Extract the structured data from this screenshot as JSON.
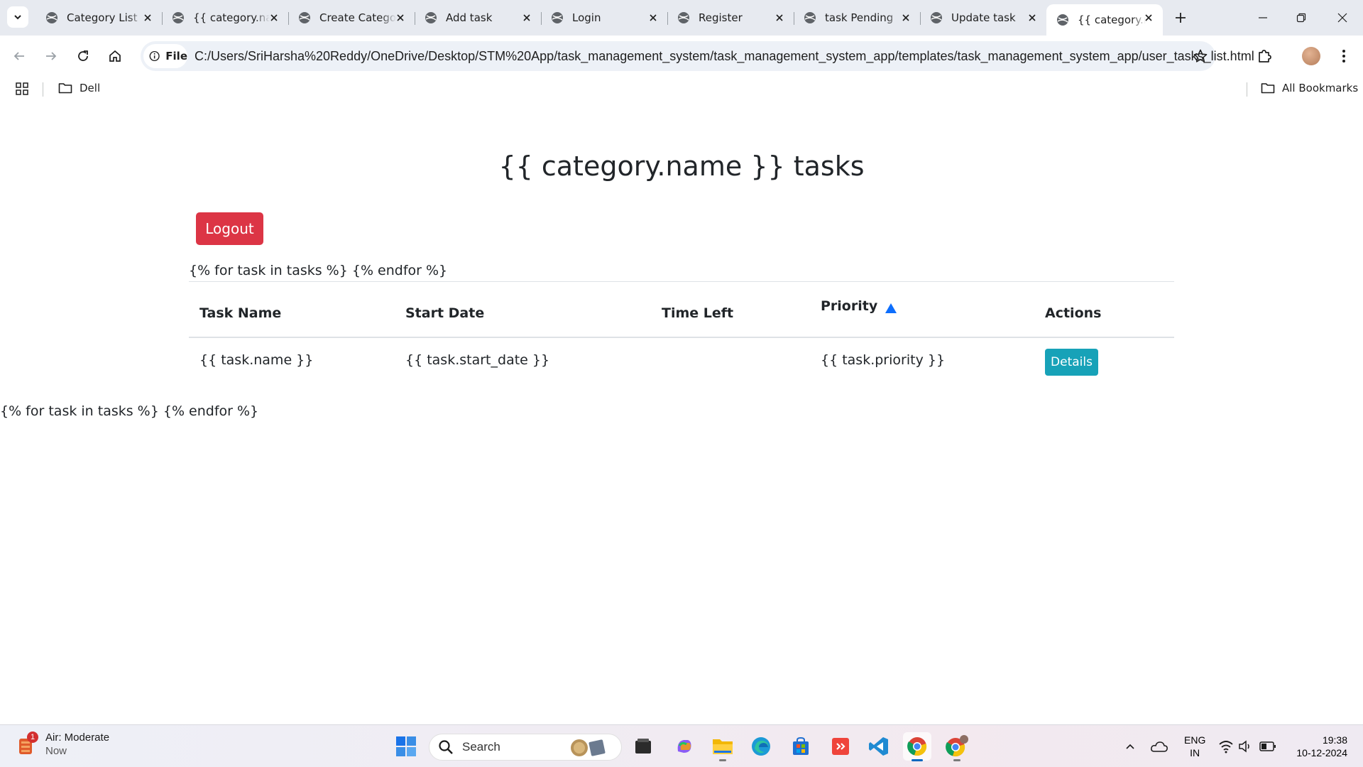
{
  "browser": {
    "tabs": [
      {
        "title": "Category List",
        "active": false
      },
      {
        "title": "{{ category.name }} tasks",
        "active": false
      },
      {
        "title": "Create Category",
        "active": false
      },
      {
        "title": "Add task",
        "active": false
      },
      {
        "title": "Login",
        "active": false
      },
      {
        "title": "Register",
        "active": false
      },
      {
        "title": "task Pending",
        "active": false
      },
      {
        "title": "Update task",
        "active": false
      },
      {
        "title": "{{ category.name }} tasks",
        "active": true
      }
    ],
    "omnibox": {
      "scheme_chip": "File",
      "url": "C:/Users/SriHarsha%20Reddy/OneDrive/Desktop/STM%20App/task_management_system/task_management_system_app/templates/task_management_system_app/user_tasks_list.html"
    },
    "bookmarks": {
      "items": [
        {
          "label": "Dell",
          "icon": "folder-icon"
        }
      ],
      "all_bookmarks": "All Bookmarks"
    }
  },
  "page": {
    "title": "{{ category.name }} tasks",
    "logout_label": "Logout",
    "template_loop_text_top": "{% for task in tasks %} {% endfor %}",
    "template_loop_text_bottom": "{% for task in tasks %} {% endfor %}",
    "table": {
      "columns": [
        "Task Name",
        "Start Date",
        "Time Left",
        "Priority",
        "Actions"
      ],
      "sort_indicator": "sort-ascending-icon",
      "rows": [
        {
          "name": "{{ task.name }}",
          "start_date": "{{ task.start_date }}",
          "time_left": "",
          "priority": "{{ task.priority }}",
          "action_label": "Details"
        }
      ]
    },
    "colors": {
      "logout": "#dc3545",
      "details": "#17a2b8",
      "sort_arrow": "#0d6efd",
      "text": "#212529"
    }
  },
  "taskbar": {
    "weather": {
      "badge": "1",
      "title": "Air: Moderate",
      "subtitle": "Now"
    },
    "search_placeholder": "Search",
    "apps": [
      "windows-start-icon",
      "file-manager-icon",
      "copilot-icon",
      "file-explorer-icon",
      "edge-icon",
      "store-icon",
      "anydesk-icon",
      "vscode-icon",
      "chrome-icon",
      "chrome-profile-icon"
    ],
    "language": {
      "line1": "ENG",
      "line2": "IN"
    },
    "clock": {
      "time": "19:38",
      "date": "10-12-2024"
    }
  }
}
